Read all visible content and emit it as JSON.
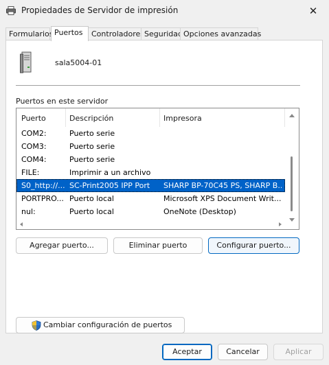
{
  "window": {
    "title": "Propiedades de Servidor de impresión",
    "close_glyph": "✕"
  },
  "tabs": [
    {
      "label": "Formularios"
    },
    {
      "label": "Puertos",
      "active": true
    },
    {
      "label": "Controladores"
    },
    {
      "label": "Seguridad"
    },
    {
      "label": "Opciones avanzadas"
    }
  ],
  "server": {
    "name": "sala5004-01",
    "icon": "server-tower-icon"
  },
  "ports_section": {
    "label": "Puertos en este servidor",
    "columns": [
      "Puerto",
      "Descripción",
      "Impresora"
    ],
    "rows": [
      {
        "port": "COM2:",
        "description": "Puerto serie",
        "printer": ""
      },
      {
        "port": "COM3:",
        "description": "Puerto serie",
        "printer": ""
      },
      {
        "port": "COM4:",
        "description": "Puerto serie",
        "printer": ""
      },
      {
        "port": "FILE:",
        "description": "Imprimir a un archivo",
        "printer": ""
      },
      {
        "port": "S0_http://...",
        "description": "SC-Print2005 IPP Port",
        "printer": "SHARP BP-70C45 PS, SHARP B...",
        "selected": true
      },
      {
        "port": "PORTPRO...",
        "description": "Puerto local",
        "printer": "Microsoft XPS Document Writ..."
      },
      {
        "port": "nul:",
        "description": "Puerto local",
        "printer": "OneNote (Desktop)"
      }
    ]
  },
  "port_buttons": {
    "add": "Agregar puerto...",
    "delete": "Eliminar puerto",
    "configure": "Configurar puerto..."
  },
  "change_settings": {
    "label": "Cambiar configuración de puertos",
    "icon": "uac-shield-icon"
  },
  "dialog_buttons": {
    "ok": "Aceptar",
    "cancel": "Cancelar",
    "apply": "Aplicar"
  },
  "colors": {
    "selection": "#0062c8",
    "accent": "#0067c0",
    "background": "#f0f0f0"
  }
}
